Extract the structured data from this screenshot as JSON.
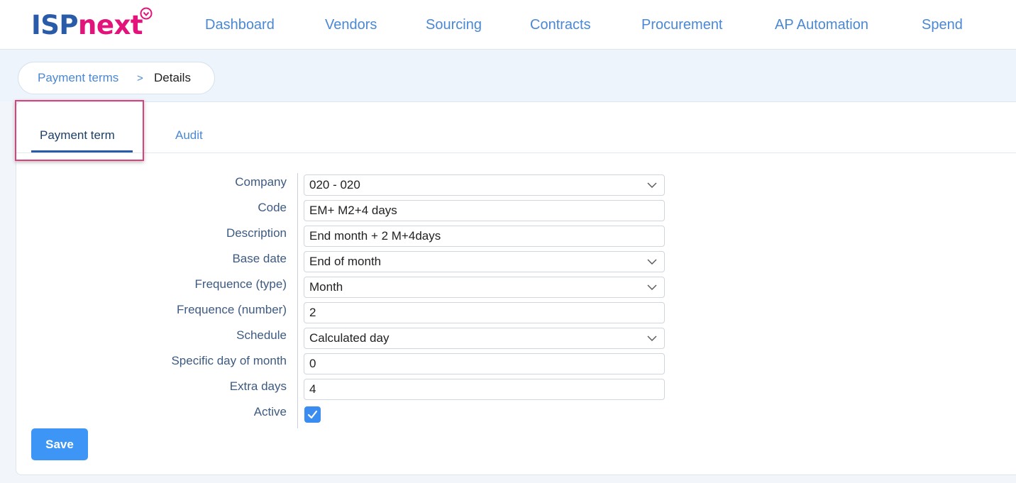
{
  "header": {
    "logo_left": "ISP",
    "logo_right": "next",
    "nav": [
      "Dashboard",
      "Vendors",
      "Sourcing",
      "Contracts",
      "Procurement",
      "AP Automation",
      "Spend"
    ]
  },
  "breadcrumb": {
    "parent": "Payment terms",
    "separator": ">",
    "current": "Details"
  },
  "tabs": [
    {
      "label": "Payment term",
      "active": true
    },
    {
      "label": "Audit",
      "active": false
    }
  ],
  "form": {
    "company": {
      "label": "Company",
      "value": "020 - 020"
    },
    "code": {
      "label": "Code",
      "value": "EM+ M2+4 days"
    },
    "description": {
      "label": "Description",
      "value": "End month + 2 M+4days"
    },
    "base_date": {
      "label": "Base date",
      "value": "End of month"
    },
    "frequence_type": {
      "label": "Frequence (type)",
      "value": "Month"
    },
    "frequence_number": {
      "label": "Frequence (number)",
      "value": "2"
    },
    "schedule": {
      "label": "Schedule",
      "value": "Calculated day"
    },
    "specific_day": {
      "label": "Specific day of month",
      "value": "0"
    },
    "extra_days": {
      "label": "Extra days",
      "value": "4"
    },
    "active": {
      "label": "Active",
      "checked": true
    }
  },
  "actions": {
    "save_label": "Save"
  },
  "colors": {
    "brand_blue": "#2a5ba8",
    "brand_pink": "#e2137a",
    "link": "#4a88d4",
    "primary_button": "#3d96f5",
    "highlight": "#d9437c"
  }
}
